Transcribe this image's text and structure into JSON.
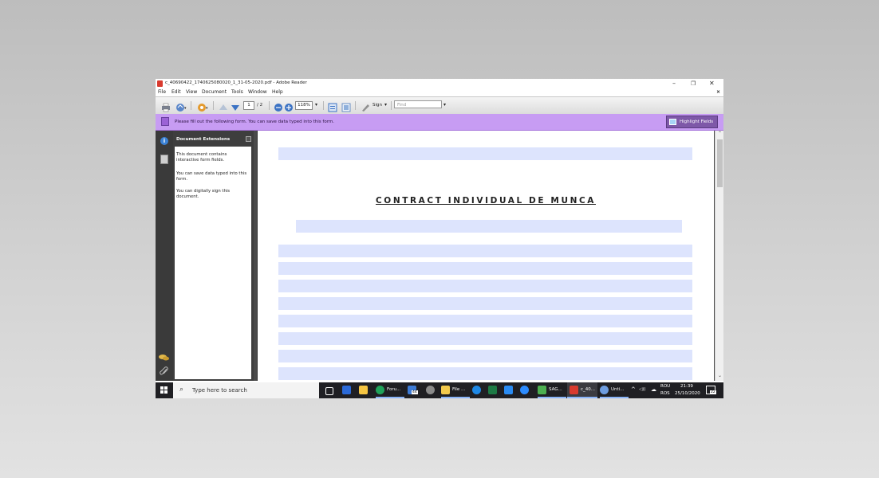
{
  "window": {
    "title": "c_40690422_1740625080020_1_31-05-2020.pdf - Adobe Reader",
    "controls": {
      "minimize": "–",
      "maximize": "❐",
      "close": "✕",
      "doc_close": "×"
    }
  },
  "menu": [
    "File",
    "Edit",
    "View",
    "Document",
    "Tools",
    "Window",
    "Help"
  ],
  "toolbar": {
    "page_current": "1",
    "page_total": "/ 2",
    "zoom": "118%",
    "sign_label": "Sign",
    "find_placeholder": "Find"
  },
  "form_bar": {
    "message": "Please fill out the following form. You can save data typed into this form.",
    "highlight_label": "Highlight Fields"
  },
  "side_panel": {
    "title": "Document Extensions",
    "lines": [
      "This document contains interactive form fields.",
      "You can save data typed into this form.",
      "You can digitally sign this document."
    ]
  },
  "document": {
    "heading": "CONTRACT INDIVIDUAL DE MUNCA"
  },
  "taskbar": {
    "search_placeholder": "Type here to search",
    "apps": [
      {
        "label": "Foru...",
        "badge": ""
      },
      {
        "label": "44",
        "badge": "44"
      },
      {
        "label": "File ...",
        "badge": ""
      },
      {
        "label": "SAG...",
        "badge": ""
      },
      {
        "label": "c_40...",
        "badge": ""
      },
      {
        "label": "Unti...",
        "badge": ""
      }
    ],
    "lang_top": "ROU",
    "lang_bottom": "ROS",
    "time": "21:39",
    "date": "25/10/2020",
    "notif_count": "22"
  },
  "colors": {
    "form_bar": "#c79cf3",
    "field_fill": "#dde4fd",
    "taskbar": "#1f1f23"
  }
}
